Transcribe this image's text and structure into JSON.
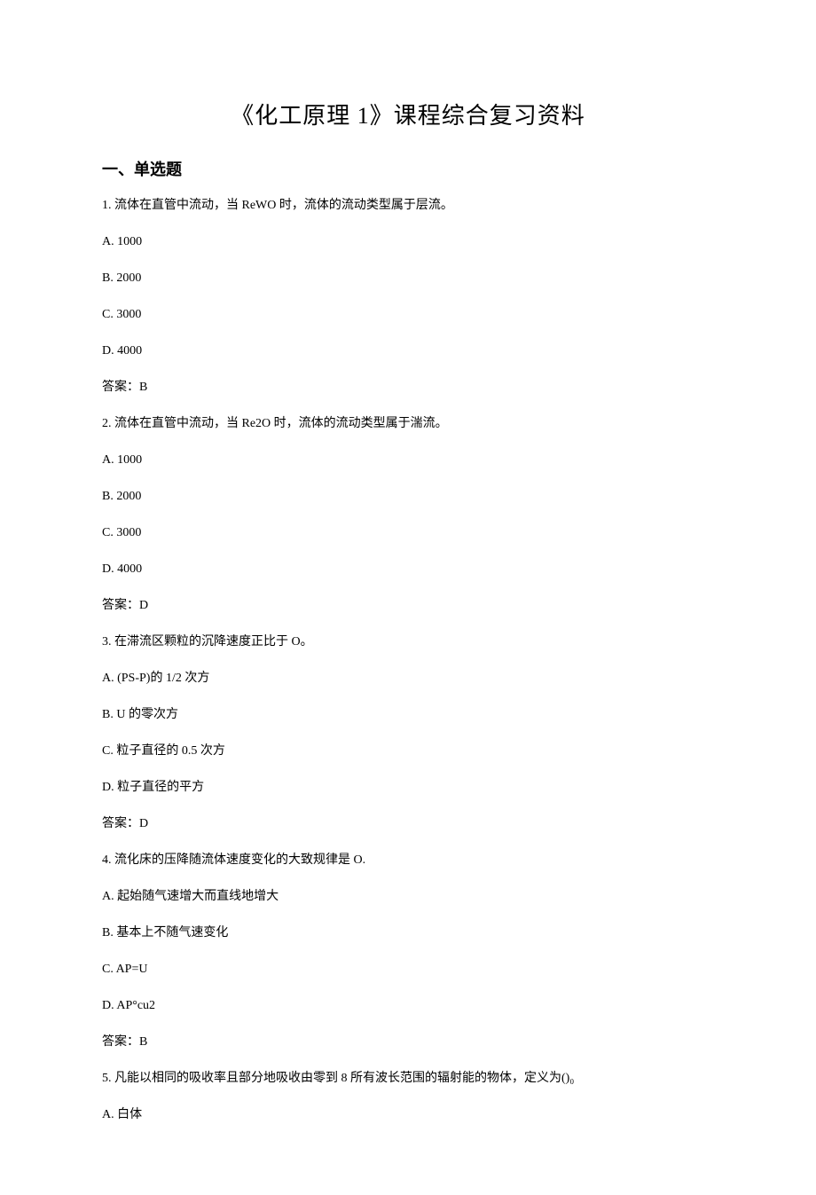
{
  "title": "《化工原理 1》课程综合复习资料",
  "sectionHeading": "一、单选题",
  "q1": {
    "stem": "1. 流体在直管中流动，当 ReWO 时，流体的流动类型属于层流。",
    "a": "A. 1000",
    "b": "B. 2000",
    "c": "C. 3000",
    "d": "D. 4000",
    "ans": "答案：B"
  },
  "q2": {
    "stem": "2. 流体在直管中流动，当 Re2O 时，流体的流动类型属于湍流。",
    "a": "A. 1000",
    "b": "B. 2000",
    "c": "C. 3000",
    "d": "D. 4000",
    "ans": "答案：D"
  },
  "q3": {
    "stem": "3. 在滞流区颗粒的沉降速度正比于 O。",
    "a": "A. (PS-P)的 1/2 次方",
    "b": "B. U 的零次方",
    "c": "C. 粒子直径的 0.5 次方",
    "d": "D. 粒子直径的平方",
    "ans": "答案：D"
  },
  "q4": {
    "stem": "4. 流化床的压降随流体速度变化的大致规律是 O.",
    "a": "A. 起始随气速增大而直线地增大",
    "b": "B. 基本上不随气速变化",
    "c": "C. AP=U",
    "d": "D. AP°cu2",
    "ans": "答案：B"
  },
  "q5": {
    "stem": "5. 凡能以相同的吸收率且部分地吸收由零到 8 所有波长范围的辐射能的物体，定义为()₀",
    "a": "A. 白体"
  }
}
